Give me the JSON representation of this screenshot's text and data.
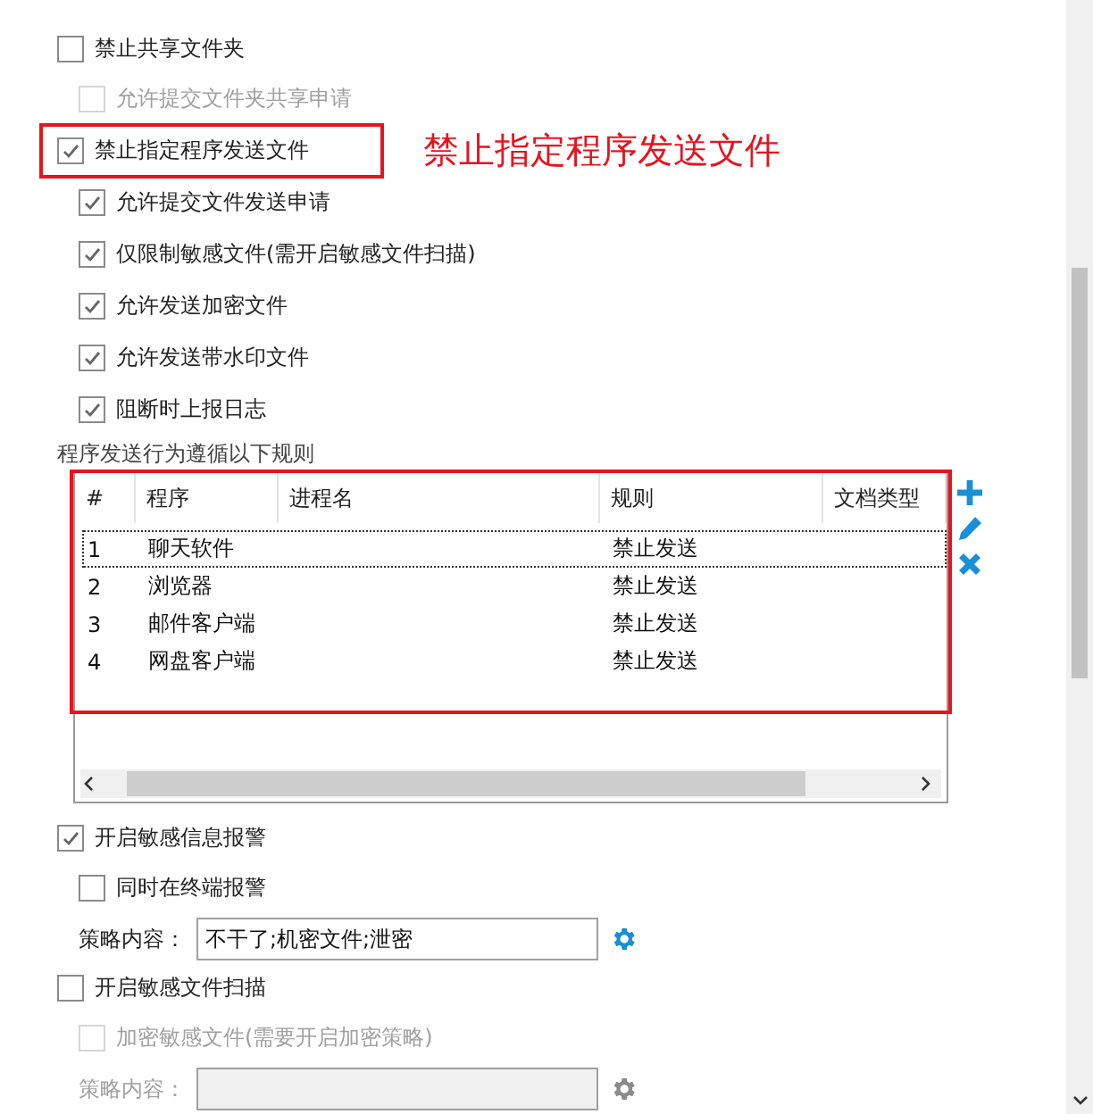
{
  "settings": [
    {
      "kind": "checkbox",
      "label": "禁止共享文件夹",
      "checked": false,
      "disabled": false,
      "children": [
        {
          "kind": "checkbox",
          "label": "允许提交文件夹共享申请",
          "checked": false,
          "disabled": true
        }
      ]
    },
    {
      "kind": "checkbox",
      "label": "禁止指定程序发送文件",
      "checked": true,
      "disabled": false,
      "highlighted": true,
      "annotation": "禁止指定程序发送文件",
      "children": [
        {
          "kind": "checkbox",
          "label": "允许提交文件发送申请",
          "checked": true,
          "disabled": false
        },
        {
          "kind": "checkbox",
          "label": "仅限制敏感文件(需开启敏感文件扫描)",
          "checked": true,
          "disabled": false
        },
        {
          "kind": "checkbox",
          "label": "允许发送加密文件",
          "checked": true,
          "disabled": false
        },
        {
          "kind": "checkbox",
          "label": "允许发送带水印文件",
          "checked": true,
          "disabled": false
        },
        {
          "kind": "checkbox",
          "label": "阻断时上报日志",
          "checked": true,
          "disabled": false
        }
      ]
    },
    {
      "kind": "rules",
      "label": "程序发送行为遵循以下规则",
      "highlighted": true,
      "columns": [
        "#",
        "程序",
        "进程名",
        "规则",
        "文档类型"
      ],
      "rows": [
        {
          "cells": [
            "1",
            "聊天软件",
            null,
            "禁止发送",
            null
          ],
          "selected": true
        },
        {
          "cells": [
            "2",
            "浏览器",
            null,
            "禁止发送",
            null
          ],
          "selected": false
        },
        {
          "cells": [
            "3",
            "邮件客户端",
            null,
            "禁止发送",
            null
          ],
          "selected": false
        },
        {
          "cells": [
            "4",
            "网盘客户端",
            null,
            "禁止发送",
            null
          ],
          "selected": false
        }
      ]
    },
    {
      "kind": "checkbox",
      "label": "开启敏感信息报警",
      "checked": true,
      "disabled": false,
      "children": [
        {
          "kind": "checkbox",
          "label": "同时在终端报警",
          "checked": false,
          "disabled": false
        },
        {
          "kind": "policy",
          "label": "策略内容：",
          "value": "不干了;机密文件;泄密",
          "disabled": false
        }
      ]
    },
    {
      "kind": "checkbox",
      "label": "开启敏感文件扫描",
      "checked": false,
      "disabled": false,
      "children": [
        {
          "kind": "checkbox",
          "label": "加密敏感文件(需要开启加密策略)",
          "checked": false,
          "disabled": true
        },
        {
          "kind": "policy",
          "label": "策略内容：",
          "disabled": true
        }
      ]
    }
  ]
}
